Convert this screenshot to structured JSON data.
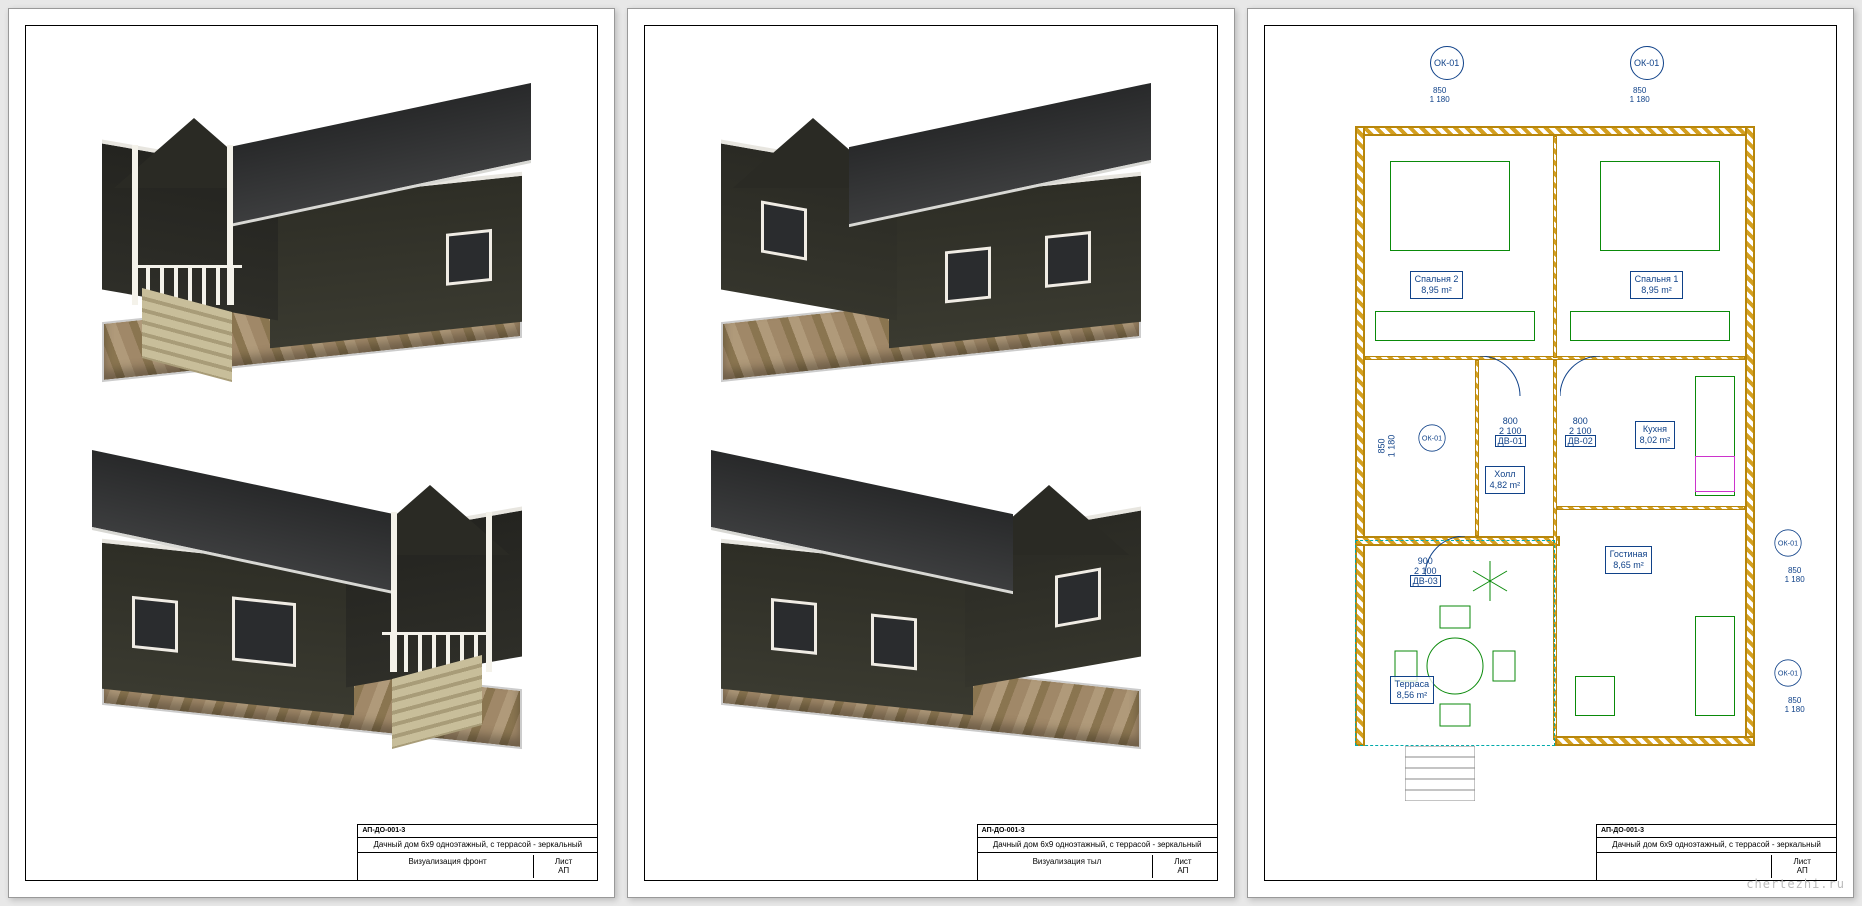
{
  "sheets": [
    {
      "titleblock": {
        "code": "АП-ДО-001-3",
        "title": "Дачный дом 6х9 одноэтажный, с террасой - зеркальный",
        "caption": "Визуализация фронт",
        "leaf_label": "Лист",
        "leaf_sub": "АП"
      }
    },
    {
      "titleblock": {
        "code": "АП-ДО-001-3",
        "title": "Дачный дом 6х9 одноэтажный, с террасой - зеркальный",
        "caption": "Визуализация тыл",
        "leaf_label": "Лист",
        "leaf_sub": "АП"
      }
    },
    {
      "titleblock": {
        "code": "АП-ДО-001-3",
        "title": "Дачный дом 6х9 одноэтажный, с террасой - зеркальный",
        "caption": "",
        "leaf_label": "Лист",
        "leaf_sub": "АП"
      }
    }
  ],
  "plan": {
    "windows": [
      {
        "tag": "ОК-01",
        "w": "850",
        "h": "1 180"
      }
    ],
    "rooms": [
      {
        "name": "Спальня 2",
        "area": "8,95 m²"
      },
      {
        "name": "Спальня 1",
        "area": "8,95 m²"
      },
      {
        "name": "Холл",
        "area": "4,82 m²"
      },
      {
        "name": "Кухня",
        "area": "8,02 m²"
      },
      {
        "name": "Гостиная",
        "area": "8,65 m²"
      },
      {
        "name": "Терраса",
        "area": "8,56 m²"
      }
    ],
    "doors": [
      {
        "tag": "ДВ-01",
        "w": "800",
        "h": "2 100"
      },
      {
        "tag": "ДВ-02",
        "w": "800",
        "h": "2 100"
      },
      {
        "tag": "ДВ-03",
        "w": "900",
        "h": "2 100"
      }
    ],
    "window_tag": "ОК-01",
    "dim_850": "850",
    "dim_1180": "1 180"
  },
  "watermark": "chertezhi.ru"
}
